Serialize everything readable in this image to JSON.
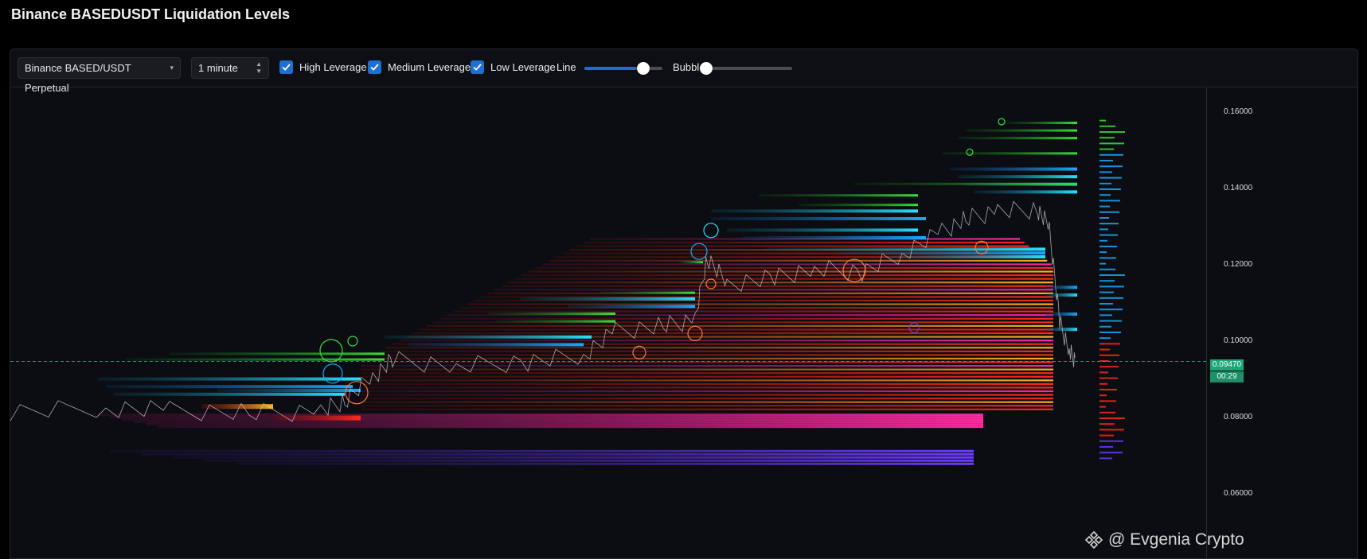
{
  "page_title": "Binance BASEDUSDT Liquidation Levels",
  "toolbar": {
    "exchange_select": "Binance BASED/USDT Perpetual",
    "interval_select": "1 minute",
    "checks": [
      {
        "label": "High Leverage",
        "checked": true
      },
      {
        "label": "Medium Leverage",
        "checked": true
      },
      {
        "label": "Low Leverage",
        "checked": true
      }
    ],
    "line_label": "Line",
    "line_value": 0.75,
    "bubble_label": "Bubble",
    "bubble_value": 0.0
  },
  "axis": {
    "ticks": [
      "0.16000",
      "0.14000",
      "0.12000",
      "0.10000",
      "0.08000",
      "0.06000"
    ],
    "current_price": "0.09470",
    "countdown": "00:29"
  },
  "colors": {
    "accent": "#1f6fd1",
    "price_tag": "#1aa878",
    "heat_red": "#ff2a1a",
    "heat_pink": "#ff2aa0",
    "heat_purple": "#6a3cff",
    "heat_blue": "#1aa8ff",
    "heat_cyan": "#27e0ff",
    "heat_green": "#37e03a"
  },
  "watermark": {
    "text": "@ Evgenia Crypto",
    "icon": "binance-logo-icon"
  }
}
